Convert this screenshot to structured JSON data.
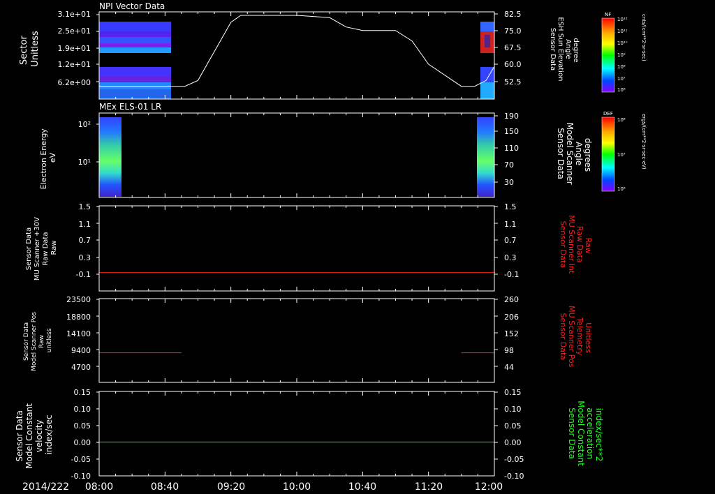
{
  "chart_data": [
    {
      "type": "heatmap",
      "title": "NPI Vector Data",
      "ylabel_lines": [
        "Sector",
        "Unitless"
      ],
      "yticks": [
        "3.1e+01",
        "2.5e+01",
        "1.9e+01",
        "1.2e+01",
        "6.2e+00"
      ],
      "y2label_lines": [
        "Sensor Data",
        "ESH Sun Elevation",
        "Angle",
        "degree"
      ],
      "y2ticks": [
        "82.5",
        "75.0",
        "67.5",
        "60.0",
        "52.5"
      ],
      "y2lim": [
        45,
        82.5
      ],
      "overlay_line": {
        "color": "#ffffff",
        "x": [
          "08:00",
          "08:30",
          "08:52",
          "09:00",
          "09:20",
          "09:26",
          "09:30",
          "10:00",
          "10:20",
          "10:30",
          "10:40",
          "10:55",
          "11:00",
          "11:10",
          "11:20",
          "11:40",
          "11:48",
          "11:55",
          "12:00"
        ],
        "y": [
          50.5,
          50.5,
          50.5,
          53,
          78,
          81,
          81,
          81,
          80,
          76,
          74.5,
          74.5,
          74.5,
          70,
          60,
          50.5,
          50.5,
          53,
          59
        ]
      },
      "colorbar": {
        "label": "NF",
        "units": "cnts/(cm**2-sr-sec)",
        "ticks": [
          "10¹²",
          "10¹¹",
          "10¹⁰",
          "10⁹",
          "10⁸",
          "10⁷",
          "10⁶"
        ]
      }
    },
    {
      "type": "heatmap",
      "title": "MEx ELS-01 LR",
      "ylabel_lines": [
        "Electron Energy",
        "eV"
      ],
      "yticks": [
        "10²",
        "10¹"
      ],
      "y2label_lines": [
        "Sensor Data",
        "Model Scanner",
        "Angle",
        "degrees"
      ],
      "y2ticks": [
        "190",
        "150",
        "110",
        "70",
        "30"
      ],
      "y2lim": [
        10,
        190
      ],
      "overlay_line": {
        "color": "#ffffff",
        "x": [
          "08:00",
          "12:00"
        ],
        "y": [
          10,
          10
        ]
      },
      "colorbar": {
        "label": "DEF",
        "units": "ergs/(cm**2-sr-sec-eV)",
        "ticks": [
          "10⁸",
          "10⁷",
          "10⁶"
        ]
      }
    },
    {
      "type": "line",
      "ylabel_lines": [
        "Sensor Data",
        "MU Scanner +30V",
        "Raw Data",
        "Raw"
      ],
      "yticks": [
        "1.5",
        "1.1",
        "0.7",
        "0.3",
        "-0.1"
      ],
      "ylim": [
        -0.3,
        1.5
      ],
      "y2label_lines": [
        "Sensor Data",
        "MU Scanner Int",
        "Raw Data",
        "Raw"
      ],
      "y2label_color": "#ff2020",
      "y2ticks": [
        "1.5",
        "1.1",
        "0.7",
        "0.3",
        "-0.1"
      ],
      "series": [
        {
          "color": "#ff2020",
          "x": [
            "08:00",
            "12:00"
          ],
          "y": [
            0.09,
            0.09
          ]
        }
      ]
    },
    {
      "type": "line",
      "ylabel_lines": [
        "Sensor Data",
        "Model Scanner Pos",
        "Raw",
        "unitless"
      ],
      "yticks": [
        "23500",
        "18800",
        "14100",
        "9400",
        "4700"
      ],
      "ylim": [
        0,
        23500
      ],
      "y2label_lines": [
        "Sensor Data",
        "MU Scanner Pos",
        "Telemetry",
        "Unitless"
      ],
      "y2label_color": "#ff2020",
      "y2ticks": [
        "260",
        "206",
        "152",
        "98",
        "44"
      ],
      "y2lim": [
        -10,
        260
      ],
      "series": [
        {
          "color": "#ff2020",
          "x": [
            "08:00",
            "08:50"
          ],
          "y": [
            8300,
            8300
          ]
        },
        {
          "color": "#ff2020",
          "x": [
            "11:40",
            "12:00"
          ],
          "y": [
            8300,
            8300
          ]
        }
      ]
    },
    {
      "type": "line",
      "ylabel_lines": [
        "Sensor Data",
        "Model Constant",
        "velocity",
        "index/sec"
      ],
      "yticks": [
        "0.15",
        "0.10",
        "0.05",
        "0.00",
        "-0.05",
        "-0.10"
      ],
      "ylim": [
        -0.1,
        0.15
      ],
      "y2label_lines": [
        "Sensor Data",
        "Model Constant",
        "acceleration",
        "index/sec**2"
      ],
      "y2label_color": "#20ff20",
      "y2ticks": [
        "0.15",
        "0.10",
        "0.05",
        "0.00",
        "-0.05",
        "-0.10"
      ],
      "series": [
        {
          "color": "#20ff20",
          "x": [
            "08:00",
            "12:00"
          ],
          "y": [
            0.0,
            0.0
          ]
        }
      ]
    }
  ],
  "time_axis": {
    "date_label": "2014/222",
    "ticks": [
      "08:00",
      "08:40",
      "09:20",
      "10:00",
      "10:40",
      "11:20",
      "12:00"
    ],
    "range": [
      "08:00",
      "12:00"
    ]
  }
}
